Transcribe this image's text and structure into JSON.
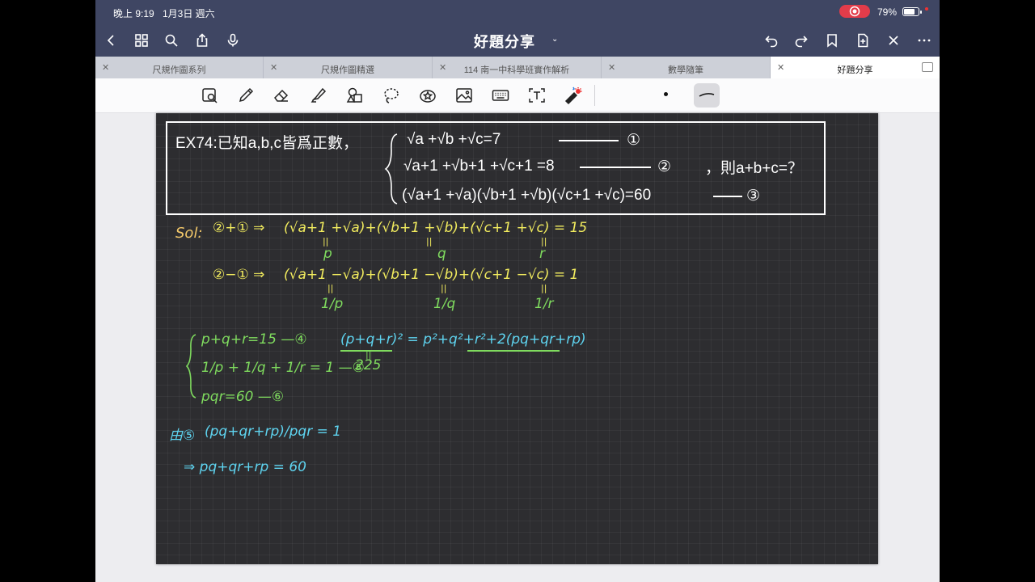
{
  "status_bar": {
    "time": "晚上 9:19",
    "date": "1月3日 週六",
    "battery_percent": "79%",
    "battery_level": 0.79
  },
  "nav": {
    "title": "好題分享",
    "icons": [
      "back-icon",
      "grid-icon",
      "search-icon",
      "share-icon",
      "mic-icon",
      "undo-icon",
      "redo-icon",
      "bookmark-icon",
      "add-page-icon",
      "close-icon",
      "more-icon"
    ]
  },
  "tabs": [
    {
      "label": "尺規作圖系列",
      "active": false
    },
    {
      "label": "尺規作圖精選",
      "active": false
    },
    {
      "label": "114 南一中科學班實作解析",
      "active": false
    },
    {
      "label": "數學隨筆",
      "active": false
    },
    {
      "label": "好題分享",
      "active": true
    }
  ],
  "toolbar": {
    "tools": [
      "lasso-zoom-icon",
      "pen-icon",
      "eraser-icon",
      "highlighter-icon",
      "shapes-icon",
      "lasso-icon",
      "sticker-icon",
      "image-icon",
      "keyboard-icon",
      "text-icon",
      "laser-pointer-icon"
    ]
  },
  "note": {
    "question": {
      "prefix": "EX74:已知a,b,c皆爲正數，",
      "eq1": "√a +√b +√c=7",
      "eq1_mark": "①",
      "eq2": "√a+1 +√b+1 +√c+1 =8",
      "eq2_mark": "②",
      "eq3": "(√a+1 +√a)(√b+1 +√b)(√c+1 +√c)=60",
      "eq3_mark": "③",
      "ask": "，則a+b+c=？"
    },
    "solution": {
      "sol_label": "Sol:",
      "line1_op": "②+① ⇒",
      "line1": "(√a+1 +√a)+(√b+1 +√b)+(√c+1 +√c) = 15",
      "sub_p": "p",
      "sub_q": "q",
      "sub_r": "r",
      "line2_op": "②−① ⇒",
      "line2": "(√a+1 −√a)+(√b+1 −√b)+(√c+1 −√c) = 1",
      "sub_1p": "1/p",
      "sub_1q": "1/q",
      "sub_1r": "1/r",
      "sys1": "p+q+r=15 —④",
      "sys2": "1/p + 1/q + 1/r = 1 —⑤",
      "sys3": "pqr=60  —⑥",
      "square_eq": "(p+q+r)² = p²+q²+r²+2(pq+qr+rp)",
      "square_val": "225",
      "from5_label": "由⑤",
      "from5": "(pq+qr+rp)/pqr = 1",
      "result": "⇒ pq+qr+rp = 60"
    }
  }
}
